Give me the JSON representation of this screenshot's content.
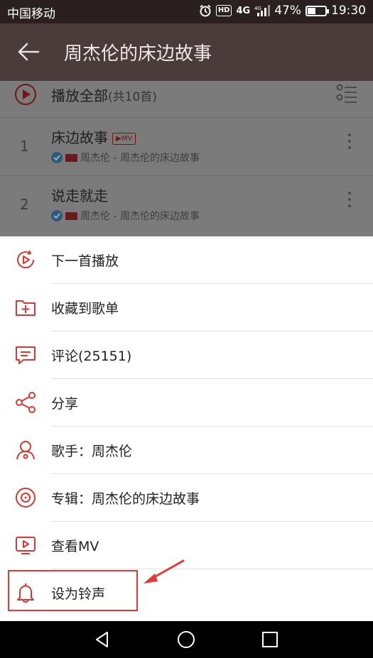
{
  "status_bar": {
    "carrier": "中国移动",
    "hd": "HD",
    "network": "4G",
    "signal_type": "4G",
    "battery_percent": "47%",
    "battery_level": 0.47,
    "time": "19:30"
  },
  "header": {
    "title": "周杰伦的床边故事"
  },
  "play_all": {
    "label": "播放全部",
    "count": "(共10首)"
  },
  "songs": [
    {
      "index": "1",
      "title": "床边故事",
      "mv_badge": "▶MV",
      "subtitle": "周杰伦 - 周杰伦的床边故事"
    },
    {
      "index": "2",
      "title": "说走就走",
      "subtitle": "周杰伦 - 周杰伦的床边故事"
    }
  ],
  "menu": {
    "items": [
      {
        "label": "下一首播放",
        "icon": "play-next-icon"
      },
      {
        "label": "收藏到歌单",
        "icon": "add-to-folder-icon"
      },
      {
        "label": "评论(25151)",
        "icon": "comment-icon"
      },
      {
        "label": "分享",
        "icon": "share-icon"
      },
      {
        "label": "歌手：周杰伦",
        "icon": "artist-icon"
      },
      {
        "label": "专辑：周杰伦的床边故事",
        "icon": "album-icon"
      },
      {
        "label": "查看MV",
        "icon": "mv-icon"
      },
      {
        "label": "设为铃声",
        "icon": "bell-icon"
      }
    ]
  },
  "colors": {
    "accent": "#d33a31",
    "highlight": "#e53936"
  }
}
